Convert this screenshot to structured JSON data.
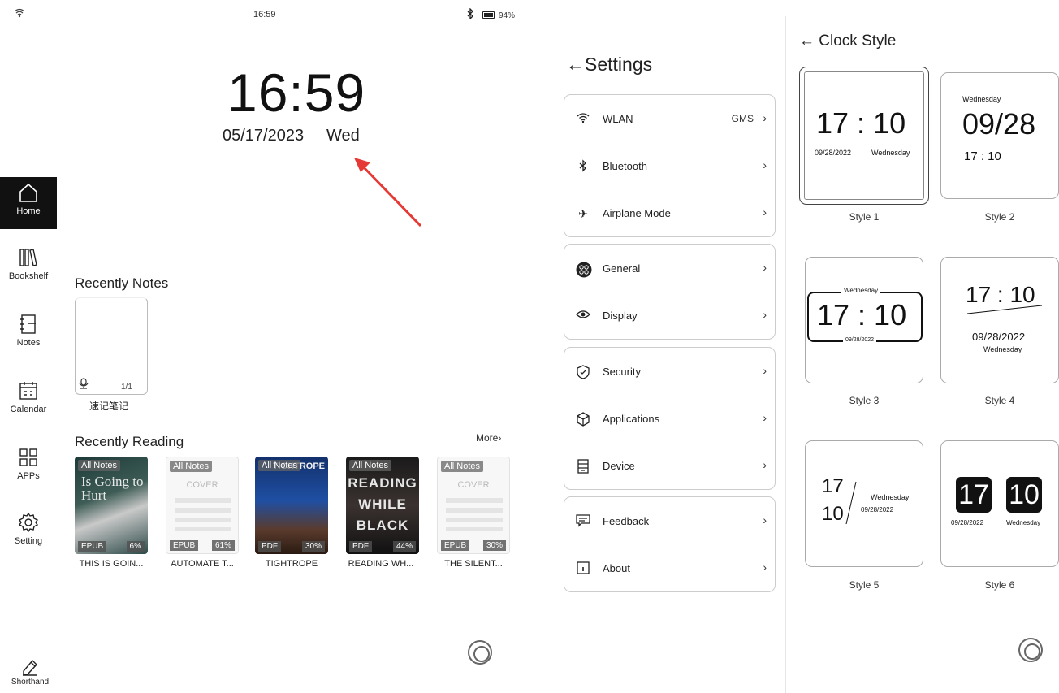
{
  "status_bar": {
    "time": "16:59",
    "battery": "94%"
  },
  "home_clock": {
    "time": "16:59",
    "date": "05/17/2023",
    "day": "Wed"
  },
  "nav": [
    {
      "label": "Home",
      "icon": "home-icon",
      "active": true
    },
    {
      "label": "Bookshelf",
      "icon": "bookshelf-icon",
      "active": false
    },
    {
      "label": "Notes",
      "icon": "notes-icon",
      "active": false
    },
    {
      "label": "Calendar",
      "icon": "calendar-icon",
      "active": false
    },
    {
      "label": "APPs",
      "icon": "apps-icon",
      "active": false
    },
    {
      "label": "Setting",
      "icon": "setting-icon",
      "active": false
    }
  ],
  "shorthand": {
    "label": "Shorthand",
    "icon": "pencil-icon"
  },
  "recent_notes": {
    "title": "Recently Notes",
    "items": [
      {
        "name": "速记笔记",
        "pages": "1/1",
        "icon": "mic-icon"
      }
    ]
  },
  "recent_reading": {
    "title": "Recently Reading",
    "more": "More",
    "books": [
      {
        "title": "THIS IS GOIN...",
        "tag": "All Notes",
        "format": "EPUB",
        "progress": "6%",
        "cover": "dark",
        "cover_text": "Is Going to Hurt"
      },
      {
        "title": "AUTOMATE T...",
        "tag": "All Notes",
        "format": "EPUB",
        "progress": "61%",
        "cover": "blank",
        "cover_text": "COVER"
      },
      {
        "title": "TIGHTROPE",
        "tag": "All Notes",
        "format": "PDF",
        "progress": "30%",
        "cover": "blue",
        "cover_text": "TIGHTROPE"
      },
      {
        "title": "READING WH...",
        "tag": "All Notes",
        "format": "PDF",
        "progress": "44%",
        "cover": "black",
        "cover_text": "READING WHILE BLACK"
      },
      {
        "title": "THE SILENT...",
        "tag": "All Notes",
        "format": "EPUB",
        "progress": "30%",
        "cover": "blank",
        "cover_text": "COVER"
      }
    ]
  },
  "settings": {
    "title": "Settings",
    "back_icon": "back-arrow-icon",
    "groups": [
      [
        {
          "label": "WLAN",
          "icon": "wifi-icon",
          "value": "GMS"
        },
        {
          "label": "Bluetooth",
          "icon": "bluetooth-icon",
          "value": ""
        },
        {
          "label": "Airplane Mode",
          "icon": "airplane-icon",
          "value": ""
        }
      ],
      [
        {
          "label": "General",
          "icon": "general-icon",
          "value": ""
        },
        {
          "label": "Display",
          "icon": "eye-icon",
          "value": ""
        }
      ],
      [
        {
          "label": "Security",
          "icon": "shield-icon",
          "value": ""
        },
        {
          "label": "Applications",
          "icon": "cube-icon",
          "value": ""
        },
        {
          "label": "Device",
          "icon": "device-icon",
          "value": ""
        }
      ],
      [
        {
          "label": "Feedback",
          "icon": "feedback-icon",
          "value": ""
        },
        {
          "label": "About",
          "icon": "info-icon",
          "value": ""
        }
      ]
    ]
  },
  "clock_style": {
    "title": "Clock Style",
    "selected": "Style 1",
    "styles": [
      {
        "label": "Style 1",
        "time": "17 : 10",
        "date": "09/28/2022",
        "day": "Wednesday"
      },
      {
        "label": "Style 2",
        "time": "17 : 10",
        "date": "09/28",
        "day": "Wednesday"
      },
      {
        "label": "Style 3",
        "time": "17 : 10",
        "date": "09/28/2022",
        "day": "Wednesday"
      },
      {
        "label": "Style 4",
        "time": "17 : 10",
        "date": "09/28/2022",
        "day": "Wednesday"
      },
      {
        "label": "Style 5",
        "hour": "17",
        "minute": "10",
        "date": "09/28/2022",
        "day": "Wednesday"
      },
      {
        "label": "Style 6",
        "hour": "17",
        "minute": "10",
        "date": "09/28/2022",
        "day": "Wednesday"
      }
    ]
  }
}
